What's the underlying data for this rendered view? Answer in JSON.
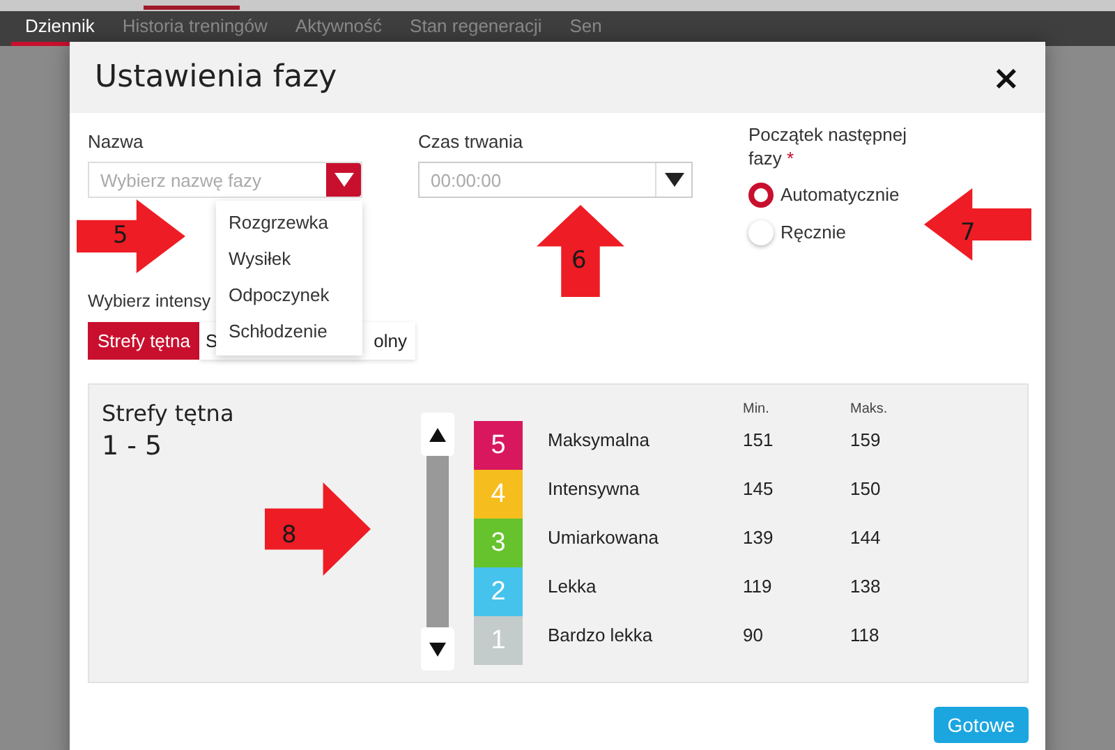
{
  "nav": {
    "tabs": [
      {
        "label": "Dziennik",
        "selected": true
      },
      {
        "label": "Historia treningów",
        "selected": false
      },
      {
        "label": "Aktywność",
        "selected": false
      },
      {
        "label": "Stan regeneracji",
        "selected": false
      },
      {
        "label": "Sen",
        "selected": false
      }
    ]
  },
  "dialog": {
    "title": "Ustawienia fazy",
    "close": "×",
    "name_field": {
      "label": "Nazwa",
      "placeholder": "Wybierz nazwę fazy",
      "expanded": true,
      "options": [
        "Rozgrzewka",
        "Wysiłek",
        "Odpoczynek",
        "Schłodzenie"
      ]
    },
    "duration_field": {
      "label": "Czas trwania",
      "placeholder": "00:00:00"
    },
    "next_phase": {
      "label": "Początek następnej fazy",
      "required_mark": "*",
      "options": [
        {
          "label": "Automatycznie",
          "selected": true
        },
        {
          "label": "Ręcznie",
          "selected": false
        }
      ]
    },
    "intensity_label": "Wybierz intensy",
    "intensity_tabs": [
      {
        "label_start": "Strefy tętna",
        "selected": true
      },
      {
        "label_start": "S",
        "label_end": "olny",
        "selected": false
      }
    ],
    "zones_panel": {
      "title": "Strefy tętna",
      "range": "1 - 5",
      "min_header": "Min.",
      "max_header": "Maks.",
      "zones": [
        {
          "number": "5",
          "name": "Maksymalna",
          "min": "151",
          "max": "159",
          "color": "#d8175f"
        },
        {
          "number": "4",
          "name": "Intensywna",
          "min": "145",
          "max": "150",
          "color": "#f6bd1e"
        },
        {
          "number": "3",
          "name": "Umiarkowana",
          "min": "139",
          "max": "144",
          "color": "#66c32e"
        },
        {
          "number": "2",
          "name": "Lekka",
          "min": "119",
          "max": "138",
          "color": "#45c3ec"
        },
        {
          "number": "1",
          "name": "Bardzo lekka",
          "min": "90",
          "max": "118",
          "color": "#c3cbcb"
        }
      ]
    },
    "done_button": "Gotowe"
  },
  "annotations": [
    {
      "number": "5",
      "kind": "right"
    },
    {
      "number": "6",
      "kind": "up"
    },
    {
      "number": "7",
      "kind": "left"
    },
    {
      "number": "8",
      "kind": "right"
    }
  ]
}
